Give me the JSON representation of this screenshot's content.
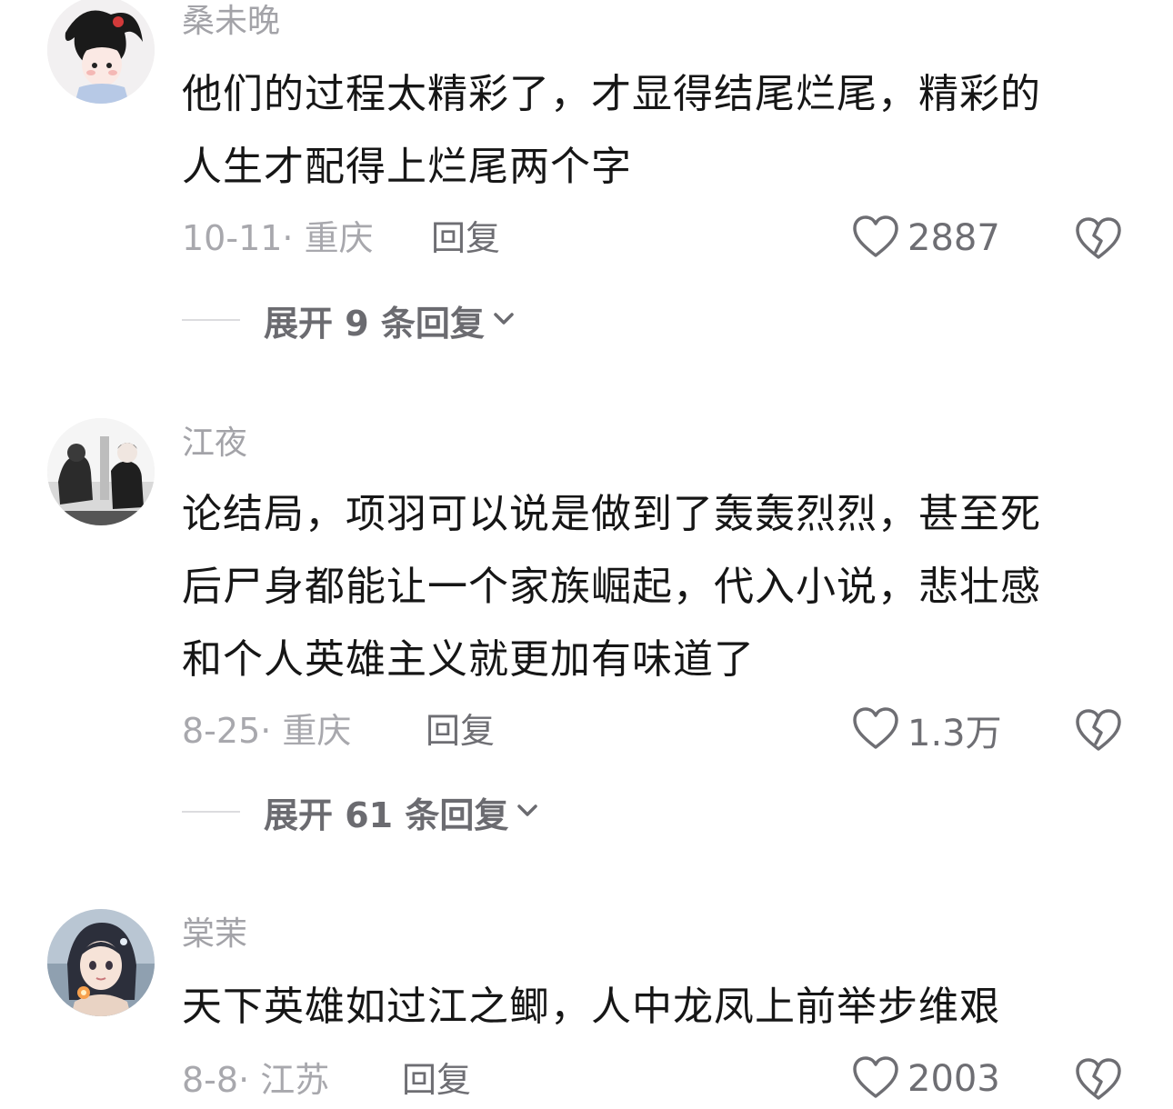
{
  "comments": [
    {
      "username": "桑未晚",
      "lines": [
        "他们的过程太精彩了，才显得结尾烂尾，精彩的",
        "人生才配得上烂尾两个字"
      ],
      "meta": "10-11· 重庆",
      "reply_label": "回复",
      "likes": "2887",
      "expand_label": "展开 9 条回复"
    },
    {
      "username": "江夜",
      "lines": [
        "论结局，项羽可以说是做到了轰轰烈烈，甚至死",
        "后尸身都能让一个家族崛起，代入小说，悲壮感",
        "和个人英雄主义就更加有味道了"
      ],
      "meta": "8-25· 重庆",
      "reply_label": "回复",
      "likes": "1.3万",
      "expand_label": "展开 61 条回复"
    },
    {
      "username": "棠茉",
      "lines": [
        "天下英雄如过江之鲫，人中龙凤上前举步维艰"
      ],
      "meta": "8-8· 江苏",
      "reply_label": "回复",
      "likes": "2003"
    }
  ],
  "icons": {
    "like": "heart-outline-icon",
    "dislike": "broken-heart-icon",
    "expand": "chevron-down-icon"
  },
  "colors": {
    "username": "#a3a3a8",
    "text": "#161616",
    "meta": "#a8a8ad",
    "action": "#6e6e73"
  }
}
